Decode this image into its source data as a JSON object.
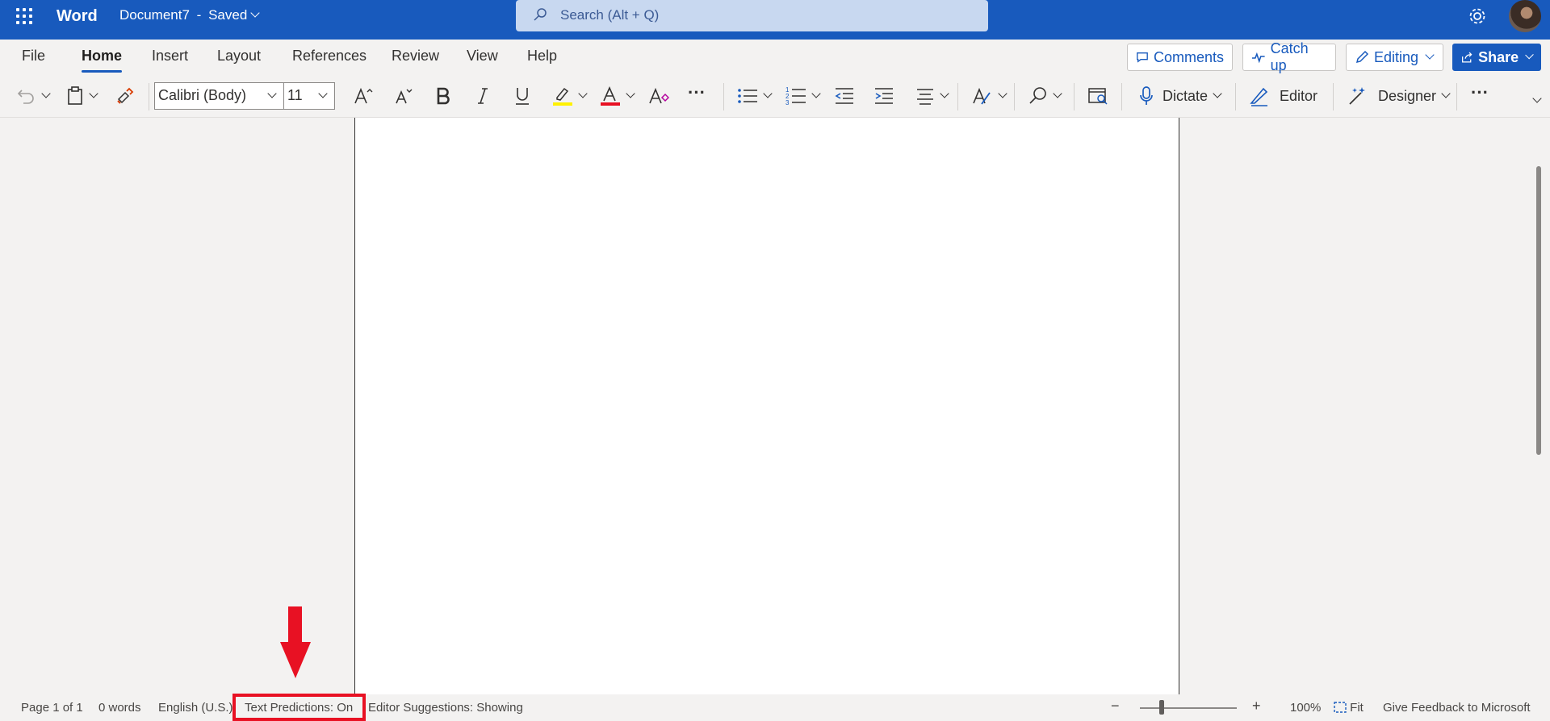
{
  "titlebar": {
    "app_name": "Word",
    "doc_name": "Document7",
    "separator": "-",
    "save_status": "Saved",
    "search_placeholder": "Search (Alt + Q)"
  },
  "menu": {
    "tabs": [
      "File",
      "Home",
      "Insert",
      "Layout",
      "References",
      "Review",
      "View",
      "Help"
    ],
    "active_tab": "Home",
    "comments_label": "Comments",
    "catchup_label": "Catch up",
    "editing_label": "Editing",
    "share_label": "Share"
  },
  "toolbar": {
    "font_name": "Calibri (Body)",
    "font_size": "11",
    "dictate_label": "Dictate",
    "editor_label": "Editor",
    "designer_label": "Designer",
    "more_label": "···"
  },
  "statusbar": {
    "page": "Page 1 of 1",
    "words": "0 words",
    "language": "English (U.S.)",
    "text_predictions": "Text Predictions: On",
    "editor_suggestions": "Editor Suggestions: Showing",
    "zoom": "100%",
    "fit": "Fit",
    "feedback": "Give Feedback to Microsoft",
    "zoom_out": "−",
    "zoom_in": "+"
  },
  "colors": {
    "brand": "#185abd",
    "annotation": "#e81123",
    "highlight_yellow": "#fff100",
    "font_red": "#e81123"
  }
}
